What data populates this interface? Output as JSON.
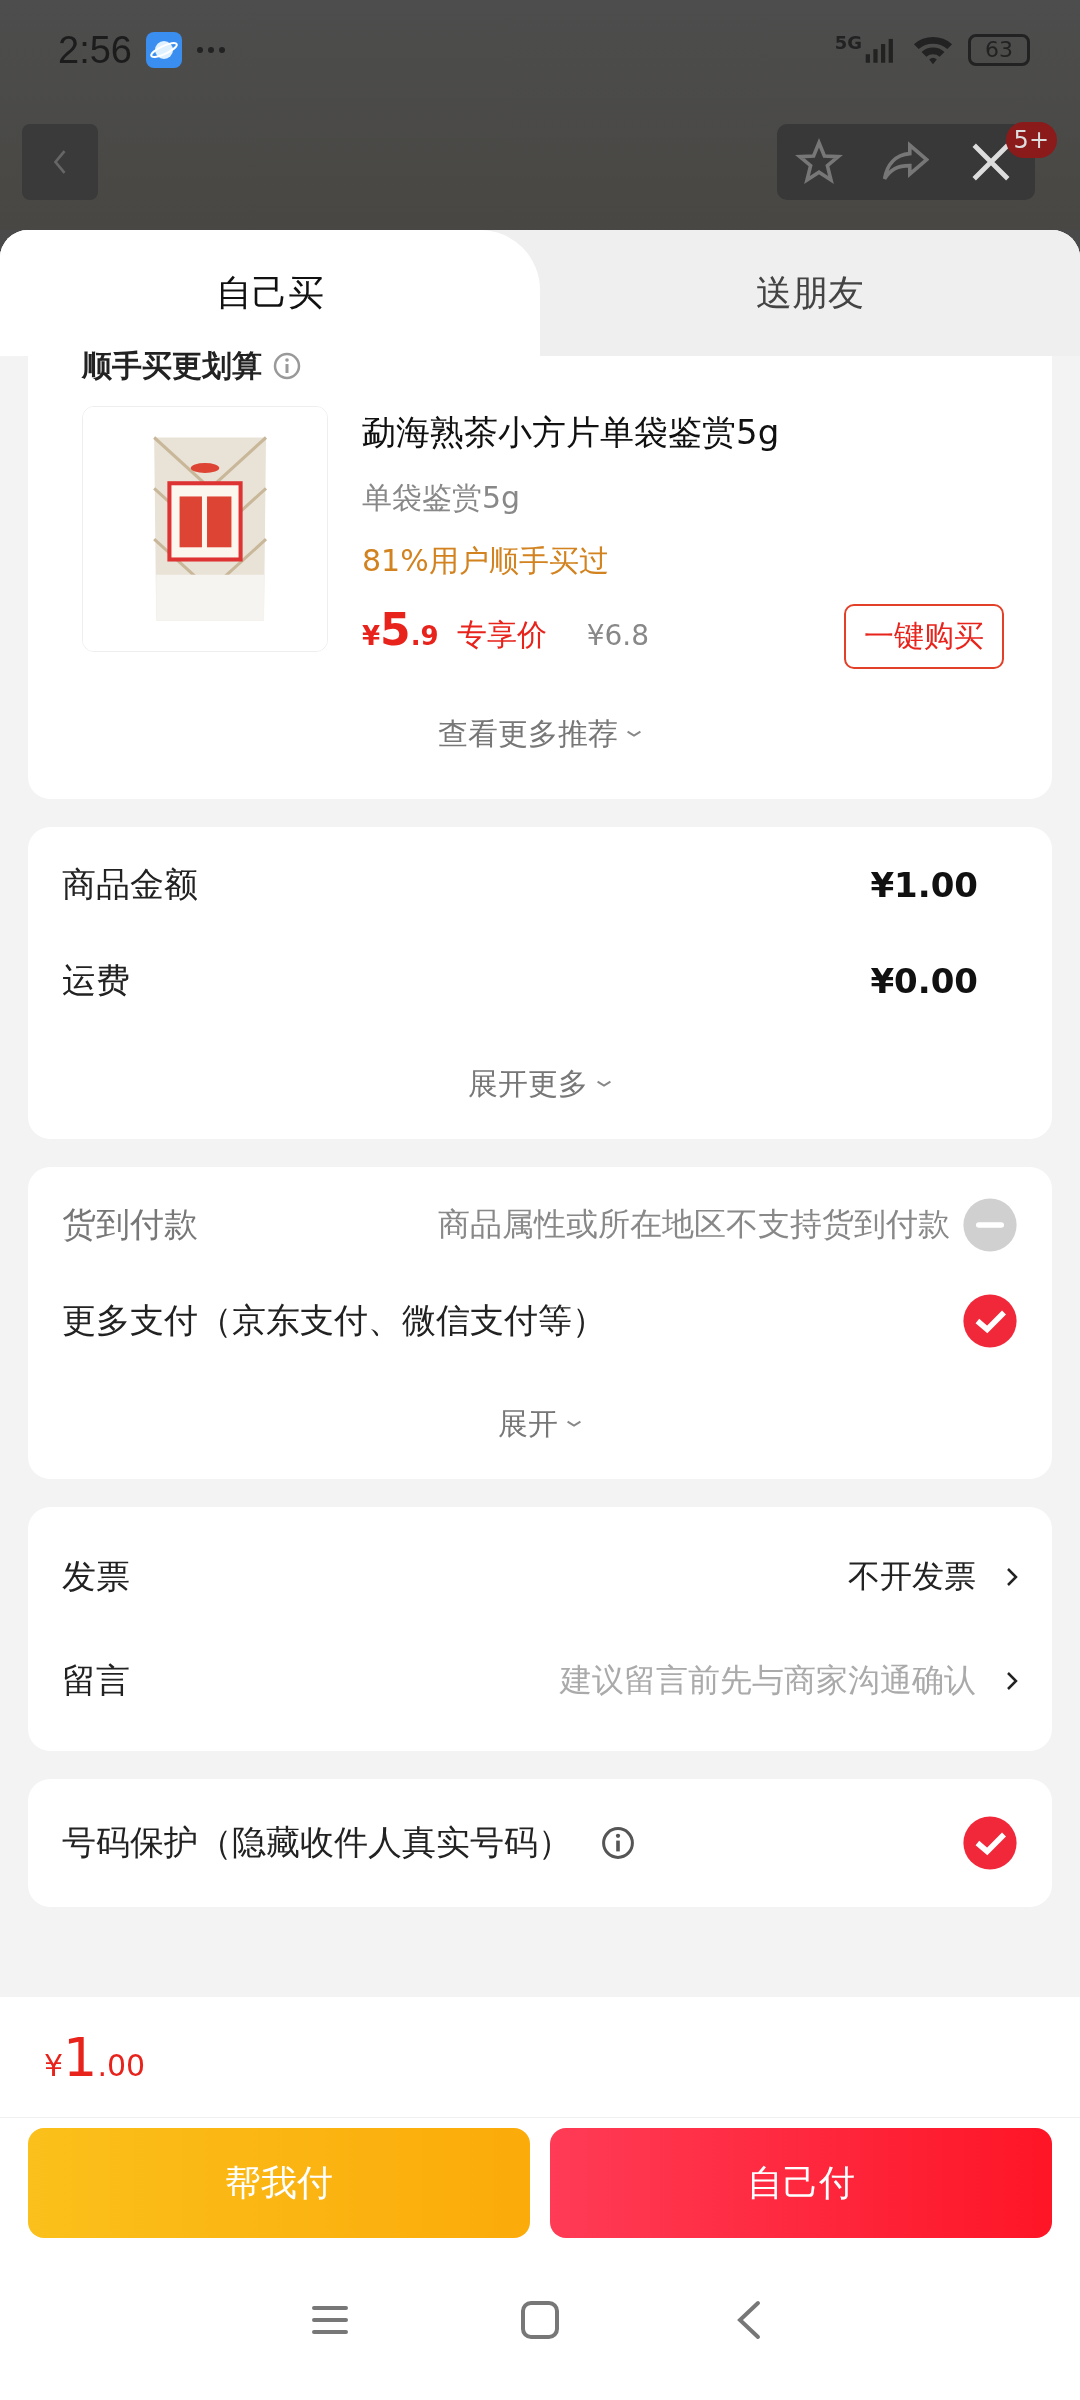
{
  "status_bar": {
    "time": "2:56",
    "network": "5G",
    "battery": "63"
  },
  "header": {
    "badge": "5+"
  },
  "tabs": [
    {
      "label": "自己买",
      "selected": true
    },
    {
      "label": "送朋友",
      "selected": false
    }
  ],
  "recommend": {
    "title": "顺手买更划算",
    "product": {
      "name": "勐海熟茶小方片单袋鉴赏5g",
      "spec": "单袋鉴赏5g",
      "social": "81%用户顺手买过",
      "price_currency": "¥",
      "price_int": "5",
      "price_dec": ".9",
      "price_tag": "专享价",
      "original_price": "¥6.8",
      "buy_button": "一键购买"
    },
    "more": "查看更多推荐"
  },
  "amounts": {
    "rows": [
      {
        "label": "商品金额",
        "value": "¥1.00"
      },
      {
        "label": "运费",
        "value": "¥0.00"
      }
    ],
    "more": "展开更多"
  },
  "payment": {
    "options": [
      {
        "label": "货到付款",
        "note": "商品属性或所在地区不支持货到付款",
        "disabled": true,
        "selected": false
      },
      {
        "label": "更多支付（京东支付、微信支付等）",
        "disabled": false,
        "selected": true
      }
    ],
    "more": "展开"
  },
  "extras": [
    {
      "label": "发票",
      "value": "不开发票",
      "kind": "value"
    },
    {
      "label": "留言",
      "value": "建议留言前先与商家沟通确认",
      "kind": "hint"
    }
  ],
  "privacy": {
    "label": "号码保护（隐藏收件人真实号码）",
    "checked": true
  },
  "footer": {
    "total_currency": "¥",
    "total_int": "1",
    "total_dec": ".00",
    "buttons": [
      {
        "label": "帮我付",
        "kind": "friend"
      },
      {
        "label": "自己付",
        "kind": "self"
      }
    ]
  }
}
